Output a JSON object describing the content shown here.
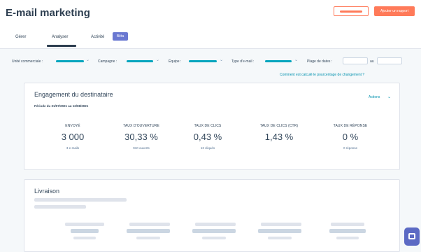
{
  "header": {
    "title": "E-mail marketing",
    "primary_button": "Ajouter un rapport"
  },
  "tabs": [
    {
      "label": "Gérer"
    },
    {
      "label": "Analyser"
    },
    {
      "label": "Activité"
    }
  ],
  "beta_badge": "Bêta",
  "filters": {
    "business_unit": "Unité commerciale :",
    "campaign": "Campagne :",
    "team": "Équipe :",
    "email_type": "Type d'e-mail :",
    "date_range": "Plage de dates :",
    "date_sep": "au"
  },
  "help_link": "Comment est calculé le pourcentage de changement ?",
  "engagement": {
    "title": "Engagement du destinataire",
    "period": "Période du 31/07/2021 au 12/08/2021",
    "actions": "Actions",
    "metrics": [
      {
        "label": "ENVOYÉ",
        "value": "3 000",
        "sub": "3 e-mails"
      },
      {
        "label": "TAUX D'OUVERTURE",
        "value": "30,33 %",
        "sub": "910 ouverts"
      },
      {
        "label": "TAUX DE CLICS",
        "value": "0,43 %",
        "sub": "13 cliqués"
      },
      {
        "label": "TAUX DE CLICS (CTR)",
        "value": "1,43 %",
        "sub": ""
      },
      {
        "label": "TAUX DE RÉPONSE",
        "value": "0 %",
        "sub": "0 réponse"
      }
    ]
  },
  "delivery": {
    "title": "Livraison"
  },
  "icons": {
    "dropdown": "chevron-down-icon",
    "chat": "chat-icon"
  },
  "colors": {
    "accent": "#ff7a59",
    "teal": "#00a4bd",
    "beta": "#6a78d1",
    "link": "#0091ae",
    "chat": "#5c6ac4"
  }
}
